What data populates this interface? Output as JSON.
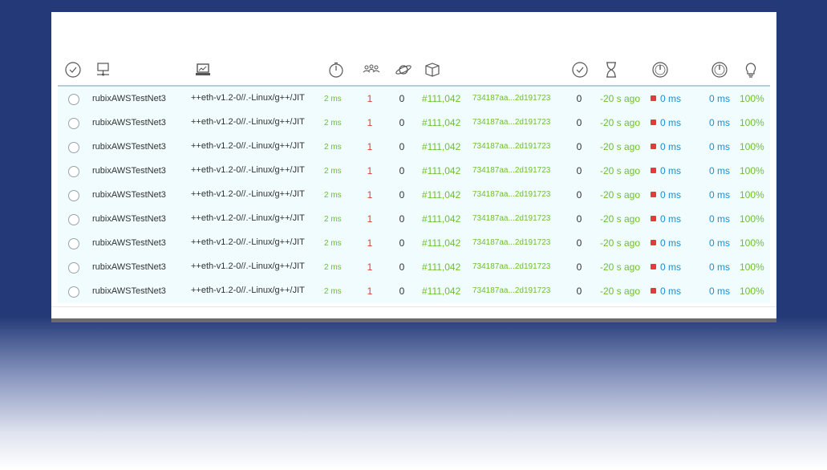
{
  "header_icons": [
    {
      "name": "check-circle-icon",
      "x": 0
    },
    {
      "name": "node-monitor-icon",
      "x": 0
    },
    {
      "name": "laptop-icon",
      "x": 0
    },
    {
      "name": "stopwatch-icon",
      "x": 0
    },
    {
      "name": "peers-group-icon",
      "x": 0
    },
    {
      "name": "planet-icon",
      "x": 0
    },
    {
      "name": "cube-icon",
      "x": 0
    },
    {
      "name": "check-circle-icon-2",
      "x": 0
    },
    {
      "name": "hourglass-icon",
      "x": 0
    },
    {
      "name": "gauge-icon",
      "x": 0
    },
    {
      "name": "gauge-icon-2",
      "x": 0
    },
    {
      "name": "lightbulb-icon",
      "x": 0
    }
  ],
  "rows": [
    {
      "name": "rubixAWSTestNet3",
      "client": "++eth-v1.2-0//.-Linux/g++/JIT",
      "latency": "2 ms",
      "peers": "1",
      "pending": "0",
      "block": "#111,042",
      "hash": "734187aa...2d191723",
      "txs": "0",
      "last_block": "-20 s ago",
      "propagation": "0 ms",
      "avg_propagation": "0 ms",
      "uptime": "100%"
    },
    {
      "name": "rubixAWSTestNet3",
      "client": "++eth-v1.2-0//.-Linux/g++/JIT",
      "latency": "2 ms",
      "peers": "1",
      "pending": "0",
      "block": "#111,042",
      "hash": "734187aa...2d191723",
      "txs": "0",
      "last_block": "-20 s ago",
      "propagation": "0 ms",
      "avg_propagation": "0 ms",
      "uptime": "100%"
    },
    {
      "name": "rubixAWSTestNet3",
      "client": "++eth-v1.2-0//.-Linux/g++/JIT",
      "latency": "2 ms",
      "peers": "1",
      "pending": "0",
      "block": "#111,042",
      "hash": "734187aa...2d191723",
      "txs": "0",
      "last_block": "-20 s ago",
      "propagation": "0 ms",
      "avg_propagation": "0 ms",
      "uptime": "100%"
    },
    {
      "name": "rubixAWSTestNet3",
      "client": "++eth-v1.2-0//.-Linux/g++/JIT",
      "latency": "2 ms",
      "peers": "1",
      "pending": "0",
      "block": "#111,042",
      "hash": "734187aa...2d191723",
      "txs": "0",
      "last_block": "-20 s ago",
      "propagation": "0 ms",
      "avg_propagation": "0 ms",
      "uptime": "100%"
    },
    {
      "name": "rubixAWSTestNet3",
      "client": "++eth-v1.2-0//.-Linux/g++/JIT",
      "latency": "2 ms",
      "peers": "1",
      "pending": "0",
      "block": "#111,042",
      "hash": "734187aa...2d191723",
      "txs": "0",
      "last_block": "-20 s ago",
      "propagation": "0 ms",
      "avg_propagation": "0 ms",
      "uptime": "100%"
    },
    {
      "name": "rubixAWSTestNet3",
      "client": "++eth-v1.2-0//.-Linux/g++/JIT",
      "latency": "2 ms",
      "peers": "1",
      "pending": "0",
      "block": "#111,042",
      "hash": "734187aa...2d191723",
      "txs": "0",
      "last_block": "-20 s ago",
      "propagation": "0 ms",
      "avg_propagation": "0 ms",
      "uptime": "100%"
    },
    {
      "name": "rubixAWSTestNet3",
      "client": "++eth-v1.2-0//.-Linux/g++/JIT",
      "latency": "2 ms",
      "peers": "1",
      "pending": "0",
      "block": "#111,042",
      "hash": "734187aa...2d191723",
      "txs": "0",
      "last_block": "-20 s ago",
      "propagation": "0 ms",
      "avg_propagation": "0 ms",
      "uptime": "100%"
    },
    {
      "name": "rubixAWSTestNet3",
      "client": "++eth-v1.2-0//.-Linux/g++/JIT",
      "latency": "2 ms",
      "peers": "1",
      "pending": "0",
      "block": "#111,042",
      "hash": "734187aa...2d191723",
      "txs": "0",
      "last_block": "-20 s ago",
      "propagation": "0 ms",
      "avg_propagation": "0 ms",
      "uptime": "100%"
    },
    {
      "name": "rubixAWSTestNet3",
      "client": "++eth-v1.2-0//.-Linux/g++/JIT",
      "latency": "2 ms",
      "peers": "1",
      "pending": "0",
      "block": "#111,042",
      "hash": "734187aa...2d191723",
      "txs": "0",
      "last_block": "-20 s ago",
      "propagation": "0 ms",
      "avg_propagation": "0 ms",
      "uptime": "100%"
    }
  ],
  "colors": {
    "green": "#6fbf2e",
    "red": "#e23b3b",
    "blue": "#1a8fd6",
    "row_bg": "#f0fcfd",
    "page_bg": "#243a78"
  }
}
